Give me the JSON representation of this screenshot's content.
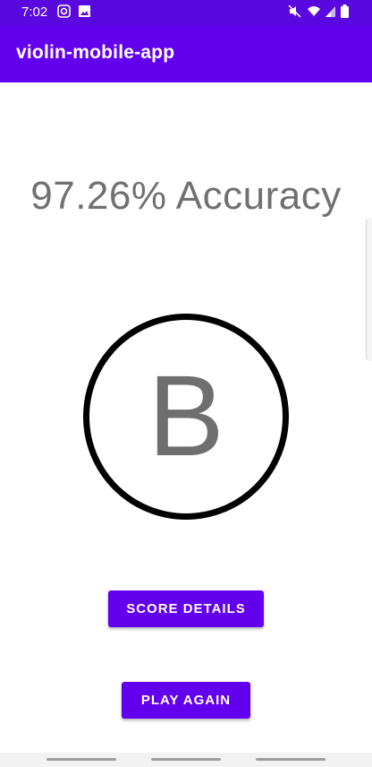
{
  "status_bar": {
    "time": "7:02",
    "icons": [
      "instagram-icon",
      "image-icon",
      "mute-icon",
      "wifi-icon",
      "signal-icon",
      "battery-icon"
    ]
  },
  "app_bar": {
    "title": "violin-mobile-app",
    "color": "#6200ee"
  },
  "result": {
    "accuracy_text": "97.26% Accuracy",
    "grade": "B"
  },
  "buttons": {
    "score_details": "SCORE DETAILS",
    "play_again": "PLAY AGAIN"
  },
  "colors": {
    "accent": "#6200ee",
    "status_bar": "#5a08e0",
    "text_gray": "#707070"
  }
}
